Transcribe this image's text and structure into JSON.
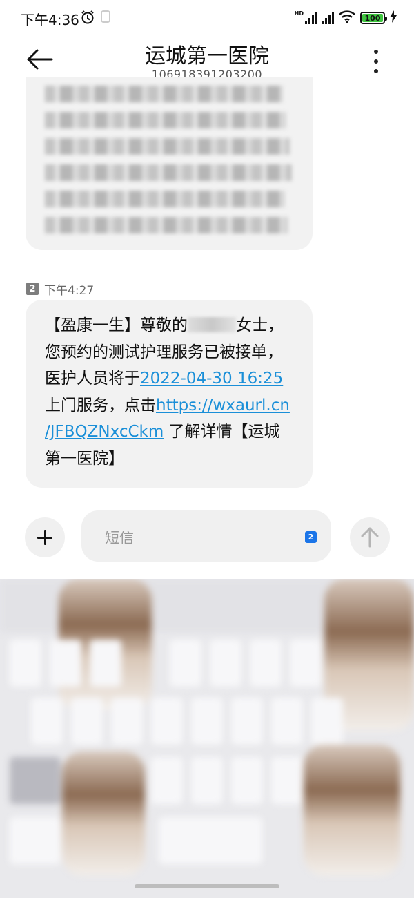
{
  "status_bar": {
    "time": "下午4:36",
    "network_label": "HD",
    "battery": "100",
    "battery_color": "#3fc53f"
  },
  "header": {
    "title": "运城第一医院",
    "subtitle": "106918391203200"
  },
  "messages": [
    {
      "sim_slot": "2",
      "time": "下午4:27",
      "text_lines": [
        "【盈康一生】尊敬的",
        "女士，",
        "您预约的测试护理服务已被接单，",
        "医护人员将于",
        "2022-04-30 16:25",
        "上门服务，点击",
        "https://wxaurl.cn",
        "/JFBQZNxcCkm",
        " 了解详情【运城",
        "第一医院】"
      ],
      "link_color": "#1a8fd8"
    }
  ],
  "composer": {
    "placeholder": "短信",
    "sim_slot": "2",
    "sim_color": "#1b75e8"
  },
  "icons": {
    "back": "arrow-left-icon",
    "more": "more-vertical-icon",
    "add": "plus-icon",
    "send": "arrow-up-icon",
    "alarm": "alarm-icon",
    "signal": "signal-icon",
    "wifi": "wifi-icon",
    "battery": "battery-icon",
    "charging": "bolt-icon"
  }
}
